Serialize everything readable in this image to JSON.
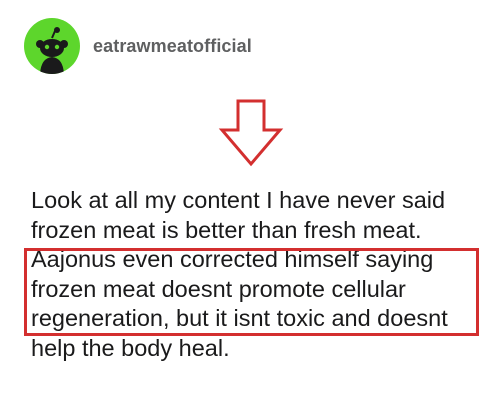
{
  "post": {
    "author": "eatrawmeatofficial",
    "avatar_icon": "reddit-snoo-icon",
    "avatar_color": "#5dd62c",
    "lines": [
      "Look at all my content I have never said",
      "frozen meat is better than fresh meat.",
      "Aajonus even corrected himself saying",
      "frozen meat doesnt promote cellular",
      "regeneration, but it isnt toxic and doesnt",
      "help the body heal."
    ]
  },
  "annotations": {
    "arrow_icon": "down-arrow-icon",
    "highlight_color": "#d32f2f"
  }
}
